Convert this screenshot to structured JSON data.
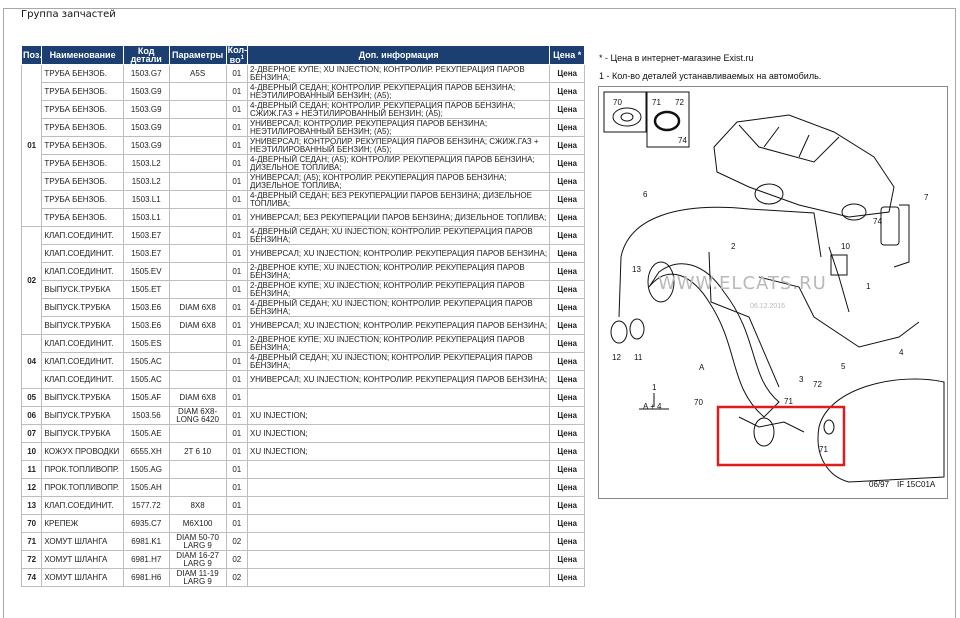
{
  "group_title": "Группа запчастей",
  "headers": {
    "pos": "Поз.",
    "name": "Наименование",
    "code": "Код детали",
    "params": "Параметры",
    "qty": "Кол-во",
    "qty_sup": "1",
    "info": "Доп. информация",
    "price": "Цена *"
  },
  "rows": [
    {
      "pos": "01",
      "name": "ТРУБА БЕНЗОБ.",
      "code": "1503.G7",
      "param": "A5S",
      "qty": "01",
      "info": "2-ДВЕРНОЕ КУПЕ; XU INJECTION; КОНТРОЛИР. РЕКУПЕРАЦИЯ ПАРОВ БЕНЗИНА;",
      "price": "Цена"
    },
    {
      "pos": "",
      "name": "ТРУБА БЕНЗОБ.",
      "code": "1503.G9",
      "param": "",
      "qty": "01",
      "info": "4-ДВЕРНЫЙ СЕДАН; КОНТРОЛИР. РЕКУПЕРАЦИЯ ПАРОВ БЕНЗИНА; НЕЭТИЛИРОВАННЫЙ БЕНЗИН; (A5);",
      "price": "Цена"
    },
    {
      "pos": "",
      "name": "ТРУБА БЕНЗОБ.",
      "code": "1503.G9",
      "param": "",
      "qty": "01",
      "info": "4-ДВЕРНЫЙ СЕДАН; КОНТРОЛИР. РЕКУПЕРАЦИЯ ПАРОВ БЕНЗИНА; СЖИЖ.ГАЗ + НЕЭТИЛИРОВАННЫЙ БЕНЗИН; (A5);",
      "price": "Цена"
    },
    {
      "pos": "",
      "name": "ТРУБА БЕНЗОБ.",
      "code": "1503.G9",
      "param": "",
      "qty": "01",
      "info": "УНИВЕРСАЛ; КОНТРОЛИР. РЕКУПЕРАЦИЯ ПАРОВ БЕНЗИНА; НЕЭТИЛИРОВАННЫЙ БЕНЗИН; (A5);",
      "price": "Цена"
    },
    {
      "pos": "",
      "name": "ТРУБА БЕНЗОБ.",
      "code": "1503.G9",
      "param": "",
      "qty": "01",
      "info": "УНИВЕРСАЛ; КОНТРОЛИР. РЕКУПЕРАЦИЯ ПАРОВ БЕНЗИНА; СЖИЖ.ГАЗ + НЕЭТИЛИРОВАННЫЙ БЕНЗИН; (A5);",
      "price": "Цена"
    },
    {
      "pos": "",
      "name": "ТРУБА БЕНЗОБ.",
      "code": "1503.L2",
      "param": "",
      "qty": "01",
      "info": "4-ДВЕРНЫЙ СЕДАН; (A5); КОНТРОЛИР. РЕКУПЕРАЦИЯ ПАРОВ БЕНЗИНА; ДИЗЕЛЬНОЕ ТОПЛИВА;",
      "price": "Цена"
    },
    {
      "pos": "",
      "name": "ТРУБА БЕНЗОБ.",
      "code": "1503.L2",
      "param": "",
      "qty": "01",
      "info": "УНИВЕРСАЛ; (A5); КОНТРОЛИР. РЕКУПЕРАЦИЯ ПАРОВ БЕНЗИНА; ДИЗЕЛЬНОЕ ТОПЛИВА;",
      "price": "Цена"
    },
    {
      "pos": "",
      "name": "ТРУБА БЕНЗОБ.",
      "code": "1503.L1",
      "param": "",
      "qty": "01",
      "info": "4-ДВЕРНЫЙ СЕДАН; БЕЗ РЕКУПЕРАЦИИ ПАРОВ БЕНЗИНА; ДИЗЕЛЬНОЕ ТОПЛИВА;",
      "price": "Цена"
    },
    {
      "pos": "",
      "name": "ТРУБА БЕНЗОБ.",
      "code": "1503.L1",
      "param": "",
      "qty": "01",
      "info": "УНИВЕРСАЛ; БЕЗ РЕКУПЕРАЦИИ ПАРОВ БЕНЗИНА; ДИЗЕЛЬНОЕ ТОПЛИВА;",
      "price": "Цена"
    },
    {
      "pos": "02",
      "name": "КЛАП.СОЕДИНИТ.",
      "code": "1503.E7",
      "param": "",
      "qty": "01",
      "info": "4-ДВЕРНЫЙ СЕДАН; XU INJECTION; КОНТРОЛИР. РЕКУПЕРАЦИЯ ПАРОВ БЕНЗИНА;",
      "price": "Цена"
    },
    {
      "pos": "",
      "name": "КЛАП.СОЕДИНИТ.",
      "code": "1503.E7",
      "param": "",
      "qty": "01",
      "info": "УНИВЕРСАЛ; XU INJECTION; КОНТРОЛИР. РЕКУПЕРАЦИЯ ПАРОВ БЕНЗИНА;",
      "price": "Цена"
    },
    {
      "pos": "",
      "name": "КЛАП.СОЕДИНИТ.",
      "code": "1505.EV",
      "param": "",
      "qty": "01",
      "info": "2-ДВЕРНОЕ КУПЕ; XU INJECTION; КОНТРОЛИР. РЕКУПЕРАЦИЯ ПАРОВ БЕНЗИНА;",
      "price": "Цена"
    },
    {
      "pos": "",
      "name": "ВЫПУСК.ТРУБКА",
      "code": "1505.ET",
      "param": "",
      "qty": "01",
      "info": "2-ДВЕРНОЕ КУПЕ; XU INJECTION; КОНТРОЛИР. РЕКУПЕРАЦИЯ ПАРОВ БЕНЗИНА;",
      "price": "Цена"
    },
    {
      "pos": "",
      "name": "ВЫПУСК.ТРУБКА",
      "code": "1503.E6",
      "param": "DIAM 6X8",
      "qty": "01",
      "info": "4-ДВЕРНЫЙ СЕДАН; XU INJECTION; КОНТРОЛИР. РЕКУПЕРАЦИЯ ПАРОВ БЕНЗИНА;",
      "price": "Цена"
    },
    {
      "pos": "",
      "name": "ВЫПУСК.ТРУБКА",
      "code": "1503.E6",
      "param": "DIAM 6X8",
      "qty": "01",
      "info": "УНИВЕРСАЛ; XU INJECTION; КОНТРОЛИР. РЕКУПЕРАЦИЯ ПАРОВ БЕНЗИНА;",
      "price": "Цена"
    },
    {
      "pos": "04",
      "name": "КЛАП.СОЕДИНИТ.",
      "code": "1505.ES",
      "param": "",
      "qty": "01",
      "info": "2-ДВЕРНОЕ КУПЕ; XU INJECTION; КОНТРОЛИР. РЕКУПЕРАЦИЯ ПАРОВ БЕНЗИНА;",
      "price": "Цена"
    },
    {
      "pos": "",
      "name": "КЛАП.СОЕДИНИТ.",
      "code": "1505.AC",
      "param": "",
      "qty": "01",
      "info": "4-ДВЕРНЫЙ СЕДАН; XU INJECTION; КОНТРОЛИР. РЕКУПЕРАЦИЯ ПАРОВ БЕНЗИНА;",
      "price": "Цена"
    },
    {
      "pos": "",
      "name": "КЛАП.СОЕДИНИТ.",
      "code": "1505.AC",
      "param": "",
      "qty": "01",
      "info": "УНИВЕРСАЛ; XU INJECTION; КОНТРОЛИР. РЕКУПЕРАЦИЯ ПАРОВ БЕНЗИНА;",
      "price": "Цена"
    },
    {
      "pos": "05",
      "name": "ВЫПУСК.ТРУБКА",
      "code": "1505.AF",
      "param": "DIAM 6X8",
      "qty": "01",
      "info": "",
      "price": "Цена"
    },
    {
      "pos": "06",
      "name": "ВЫПУСК.ТРУБКА",
      "code": "1503.56",
      "param": "DIAM 6X8-LONG 6420",
      "qty": "01",
      "info": "XU INJECTION;",
      "price": "Цена"
    },
    {
      "pos": "07",
      "name": "ВЫПУСК.ТРУБКА",
      "code": "1505.AE",
      "param": "",
      "qty": "01",
      "info": "XU INJECTION;",
      "price": "Цена"
    },
    {
      "pos": "10",
      "name": "КОЖУХ ПРОВОДКИ",
      "code": "6555.XH",
      "param": "2T 6 10",
      "qty": "01",
      "info": "XU INJECTION;",
      "price": "Цена"
    },
    {
      "pos": "11",
      "name": "ПРОК.ТОПЛИВОПР.",
      "code": "1505.AG",
      "param": "",
      "qty": "01",
      "info": "",
      "price": "Цена"
    },
    {
      "pos": "12",
      "name": "ПРОК.ТОПЛИВОПР.",
      "code": "1505.AH",
      "param": "",
      "qty": "01",
      "info": "",
      "price": "Цена"
    },
    {
      "pos": "13",
      "name": "КЛАП.СОЕДИНИТ.",
      "code": "1577.72",
      "param": "8X8",
      "qty": "01",
      "info": "",
      "price": "Цена"
    },
    {
      "pos": "70",
      "name": "КРЕПЕЖ",
      "code": "6935.C7",
      "param": "M6X100",
      "qty": "01",
      "info": "",
      "price": "Цена"
    },
    {
      "pos": "71",
      "name": "ХОМУТ ШЛАНГА",
      "code": "6981.K1",
      "param": "DIAM 50-70 LARG 9",
      "qty": "02",
      "info": "",
      "price": "Цена"
    },
    {
      "pos": "72",
      "name": "ХОМУТ ШЛАНГА",
      "code": "6981.H7",
      "param": "DIAM 16-27 LARG 9",
      "qty": "02",
      "info": "",
      "price": "Цена"
    },
    {
      "pos": "74",
      "name": "ХОМУТ ШЛАНГА",
      "code": "6981.H6",
      "param": "DIAM 11-19 LARG 9",
      "qty": "02",
      "info": "",
      "price": "Цена"
    }
  ],
  "notes": {
    "price_note": "* - Цена в интернет-магазине Exist.ru",
    "qty_note": "1 - Кол-во деталей устанавливаемых на автомобиль."
  },
  "diagram": {
    "callouts": [
      "70",
      "71",
      "72",
      "74",
      "6",
      "7",
      "74",
      "1",
      "2",
      "10",
      "13",
      "12",
      "11",
      "A",
      "3",
      "4",
      "5",
      "70",
      "72",
      "71",
      "71",
      "A + 4",
      "1"
    ],
    "code": "06/97",
    "ref": "IF 15C01A",
    "watermark": "WWW.ELCATS.RU",
    "watermark_date": "06.12.2016",
    "highlight_color": "#e01b1b"
  }
}
